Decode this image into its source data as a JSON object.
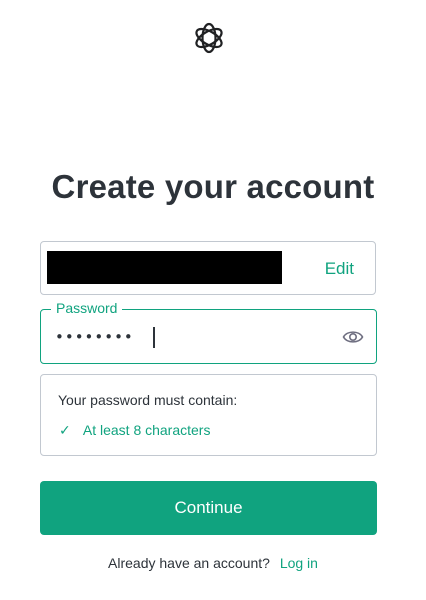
{
  "logo": {
    "icon": "openai-logo-icon"
  },
  "heading": {
    "title": "Create your account"
  },
  "email": {
    "edit_label": "Edit"
  },
  "password": {
    "label": "Password",
    "value": "••••••••",
    "toggle_icon": "eye-icon"
  },
  "requirements": {
    "title": "Your password must contain:",
    "items": [
      {
        "check": "✓",
        "text": "At least 8 characters"
      }
    ]
  },
  "continue_button": {
    "label": "Continue"
  },
  "footer": {
    "prompt": "Already have an account?",
    "login_label": "Log in"
  },
  "colors": {
    "accent": "#10a37f",
    "heading": "#2d333a",
    "border": "#c2c8d0"
  }
}
